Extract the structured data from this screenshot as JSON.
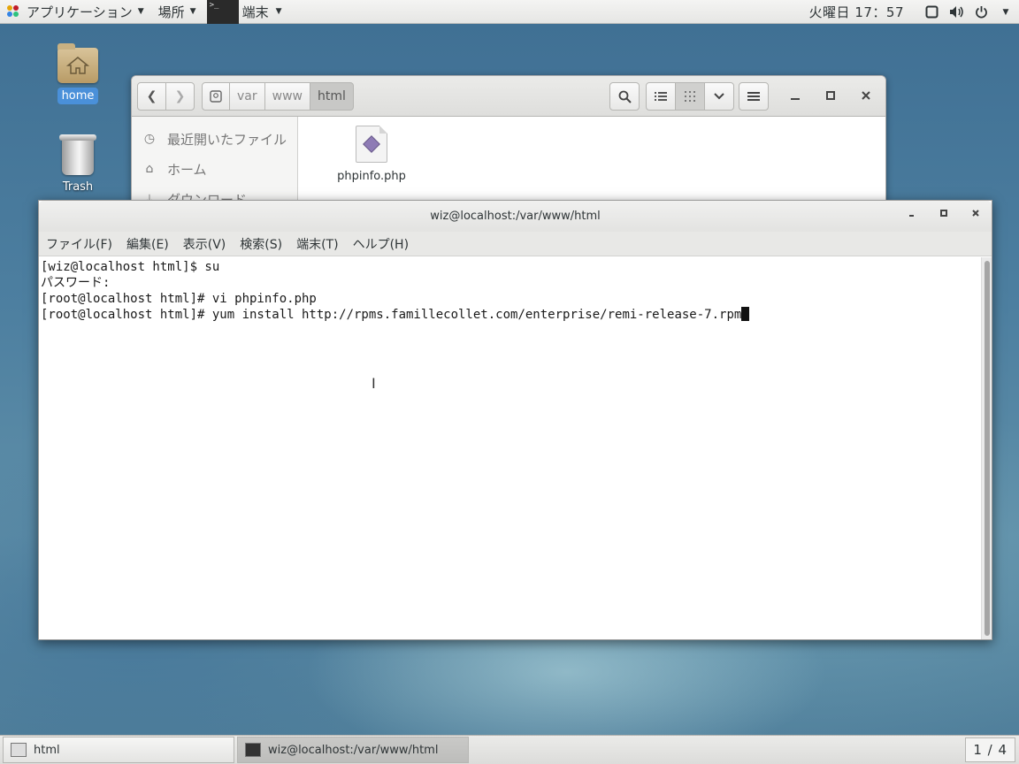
{
  "topbar": {
    "applications_label": "アプリケーション",
    "places_label": "場所",
    "terminal_label": "端末",
    "clock": "火曜日 17：57"
  },
  "desktop": {
    "home_label": "home",
    "trash_label": "Trash"
  },
  "file_manager": {
    "path": [
      "var",
      "www",
      "html"
    ],
    "sidebar": [
      {
        "label": "最近開いたファイル",
        "icon": "clock-icon"
      },
      {
        "label": "ホーム",
        "icon": "home-icon"
      },
      {
        "label": "ダウンロード",
        "icon": "download-icon"
      }
    ],
    "files": [
      {
        "name": "phpinfo.php",
        "icon": "php-file-icon"
      }
    ]
  },
  "terminal": {
    "title": "wiz@localhost:/var/www/html",
    "menu": [
      "ファイル(F)",
      "編集(E)",
      "表示(V)",
      "検索(S)",
      "端末(T)",
      "ヘルプ(H)"
    ],
    "lines": [
      "[wiz@localhost html]$ su",
      "パスワード:",
      "[root@localhost html]# vi phpinfo.php",
      "[root@localhost html]# yum install http://rpms.famillecollet.com/enterprise/remi-release-7.rpm"
    ]
  },
  "taskbar": {
    "tasks": [
      {
        "label": "html",
        "active": false
      },
      {
        "label": "wiz@localhost:/var/www/html",
        "active": true
      }
    ],
    "workspace": "1 / 4"
  }
}
